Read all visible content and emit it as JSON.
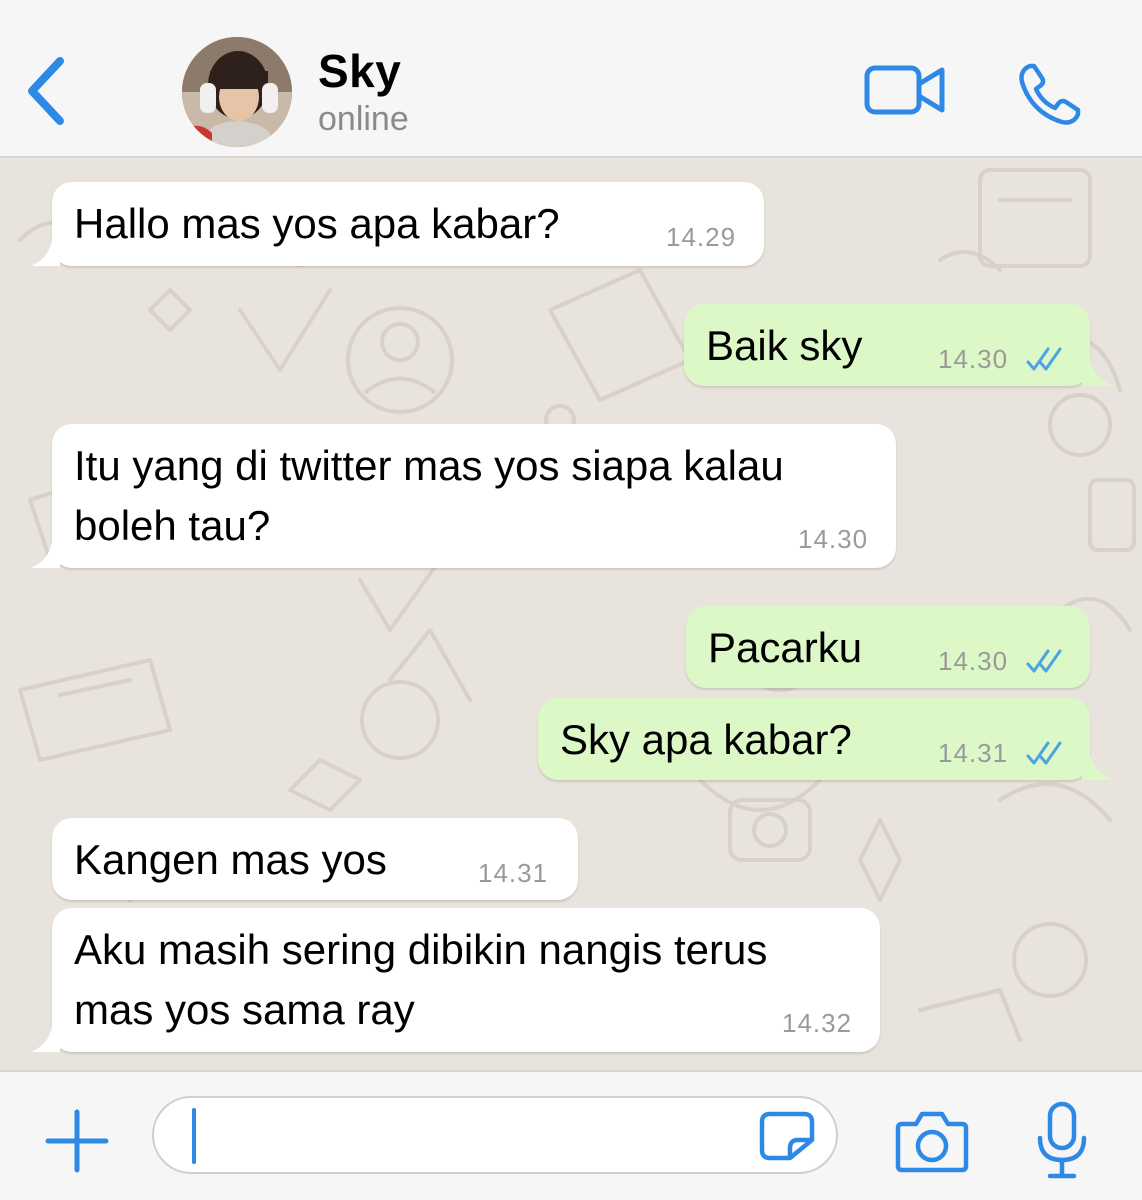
{
  "header": {
    "contact_name": "Sky",
    "status": "online",
    "icons": [
      "chevron-left-icon",
      "video-camera-icon",
      "phone-icon"
    ],
    "accent": "#2e88e6"
  },
  "messages": [
    {
      "direction": "incoming",
      "lines": [
        "Hallo mas yos apa kabar?"
      ],
      "time": "14.29"
    },
    {
      "direction": "outgoing",
      "lines": [
        "Baik sky"
      ],
      "time": "14.30",
      "status": "read"
    },
    {
      "direction": "incoming",
      "lines": [
        "Itu yang di twitter mas yos siapa kalau",
        "boleh tau?"
      ],
      "time": "14.30"
    },
    {
      "direction": "outgoing",
      "lines": [
        "Pacarku"
      ],
      "time": "14.30",
      "status": "read"
    },
    {
      "direction": "outgoing",
      "lines": [
        "Sky apa kabar?"
      ],
      "time": "14.31",
      "status": "read"
    },
    {
      "direction": "incoming",
      "lines": [
        "Kangen mas yos"
      ],
      "time": "14.31"
    },
    {
      "direction": "incoming",
      "lines": [
        "Aku masih sering dibikin nangis terus",
        "mas yos sama ray"
      ],
      "time": "14.32"
    }
  ],
  "composer": {
    "value": "",
    "icons": [
      "plus-icon",
      "sticker-icon",
      "camera-icon",
      "microphone-icon"
    ]
  },
  "colors": {
    "incoming_bubble": "#ffffff",
    "outgoing_bubble": "#dcf8c6",
    "read_ticks": "#4fa3e3",
    "chat_background": "#e8e3dc"
  }
}
